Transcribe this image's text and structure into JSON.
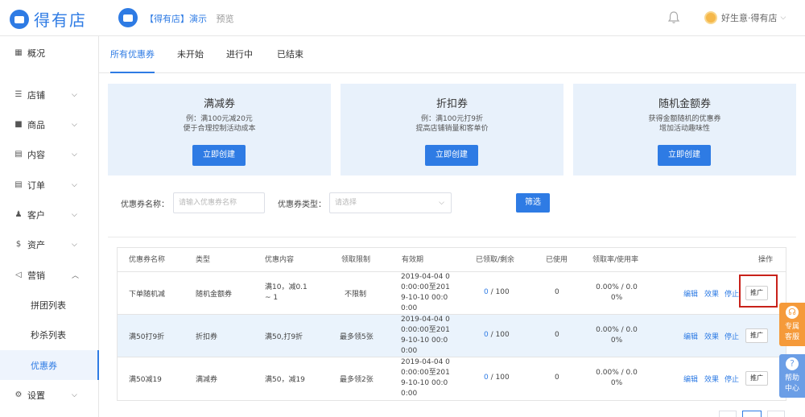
{
  "brand": {
    "name": "得有店"
  },
  "shop": {
    "name": "【得有店】演示",
    "preview": "预览"
  },
  "user": {
    "name": "好生意·得有店"
  },
  "sidebar": {
    "items": [
      {
        "label": "概况",
        "icon": "grid-icon"
      },
      {
        "label": "店铺",
        "icon": "sliders-icon"
      },
      {
        "label": "商品",
        "icon": "box-icon"
      },
      {
        "label": "内容",
        "icon": "file-icon"
      },
      {
        "label": "订单",
        "icon": "list-icon"
      },
      {
        "label": "客户",
        "icon": "person-icon"
      },
      {
        "label": "资产",
        "icon": "dollar-icon"
      },
      {
        "label": "营销",
        "icon": "megaphone-icon"
      },
      {
        "label": "设置",
        "icon": "gear-icon"
      }
    ],
    "sub_items": [
      {
        "label": "拼团列表"
      },
      {
        "label": "秒杀列表"
      },
      {
        "label": "优惠券"
      }
    ]
  },
  "tabs": [
    "所有优惠券",
    "未开始",
    "进行中",
    "已结束"
  ],
  "cards": [
    {
      "title": "满减券",
      "desc1": "例：满100元减20元",
      "desc2": "便于合理控制活动成本",
      "button": "立即创建"
    },
    {
      "title": "折扣券",
      "desc1": "例：满100元打9折",
      "desc2": "提高店铺销量和客单价",
      "button": "立即创建"
    },
    {
      "title": "随机金额券",
      "desc1": "获得金额随机的优惠券",
      "desc2": "增加活动趣味性",
      "button": "立即创建"
    }
  ],
  "filter": {
    "name_label": "优惠券名称：",
    "name_placeholder": "请输入优惠券名称",
    "type_label": "优惠券类型：",
    "type_placeholder": "请选择",
    "button": "筛选"
  },
  "table": {
    "headers": [
      "优惠券名称",
      "类型",
      "优惠内容",
      "领取限制",
      "有效期",
      "已领取/剩余",
      "已使用",
      "领取率/使用率",
      "操作"
    ],
    "rows": [
      {
        "name": "下单随机减",
        "type": "随机金额券",
        "content1": "满10，减0.1",
        "content2": "~ 1",
        "limit": "不限制",
        "valid1": "2019-04-04 0",
        "valid2": "0:00:00至201",
        "valid3": "9-10-10 00:0",
        "valid4": "0:00",
        "claimed": "0",
        "remain": "/ 100",
        "used": "0",
        "rate1": "0.00% / 0.0",
        "rate2": "0%"
      },
      {
        "name": "满50打9折",
        "type": "折扣券",
        "content1": "满50,打9折",
        "content2": "",
        "limit": "最多领5张",
        "valid1": "2019-04-04 0",
        "valid2": "0:00:00至201",
        "valid3": "9-10-10 00:0",
        "valid4": "0:00",
        "claimed": "0",
        "remain": "/ 100",
        "used": "0",
        "rate1": "0.00% / 0.0",
        "rate2": "0%"
      },
      {
        "name": "满50减19",
        "type": "满减券",
        "content1": "满50，减19",
        "content2": "",
        "limit": "最多领2张",
        "valid1": "2019-04-04 0",
        "valid2": "0:00:00至201",
        "valid3": "9-10-10 00:0",
        "valid4": "0:00",
        "claimed": "0",
        "remain": "/ 100",
        "used": "0",
        "rate1": "0.00% / 0.0",
        "rate2": "0%"
      }
    ],
    "actions": {
      "edit": "编辑",
      "effect": "效果",
      "stop": "停止",
      "promote": "推广"
    }
  },
  "floating": {
    "service1": "专属",
    "service2": "客服",
    "help1": "帮助",
    "help2": "中心"
  }
}
